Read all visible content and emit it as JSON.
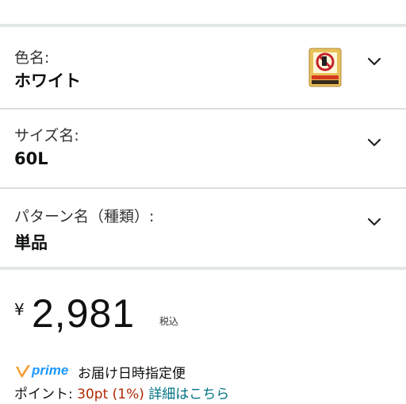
{
  "variations": [
    {
      "label": "色名:",
      "value": "ホワイト"
    },
    {
      "label": "サイズ名:",
      "value": "60L"
    },
    {
      "label": "パターン名（種類）:",
      "value": "単品"
    }
  ],
  "price": {
    "currency": "¥",
    "amount": "2,981",
    "tax_note": "税込"
  },
  "prime": {
    "logo_text": "prime",
    "delivery_text": "お届け日時指定便"
  },
  "points": {
    "label": "ポイント:",
    "value": "30pt",
    "percent": "(1%)",
    "details_link": "詳細はこちら"
  },
  "colors": {
    "prime_blue": "#1a98ff",
    "prime_orange": "#f79c34",
    "points_red": "#b12704",
    "link_teal": "#007185"
  },
  "icons": {
    "chevron": "chevron-down-icon",
    "thumbnail": "product-thumbnail"
  }
}
